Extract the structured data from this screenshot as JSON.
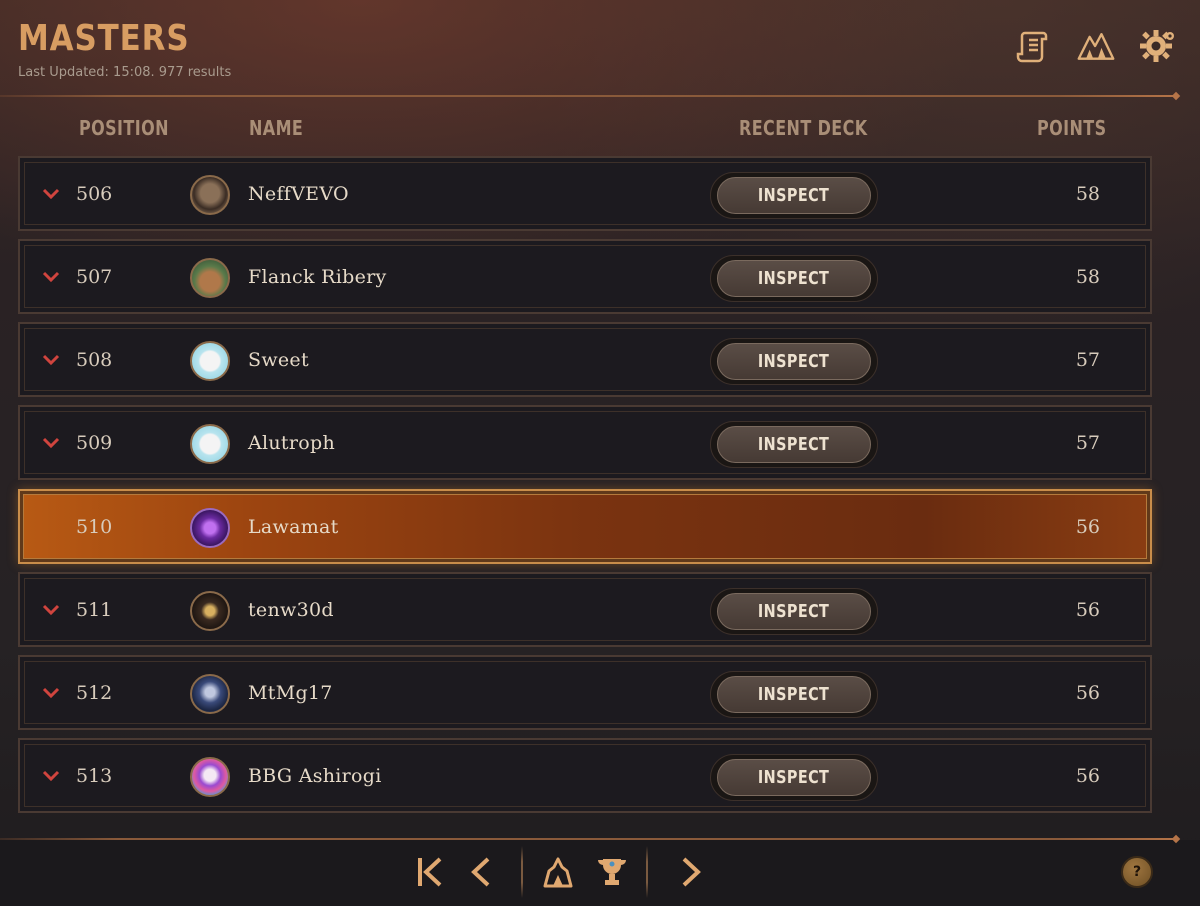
{
  "header": {
    "title": "MASTERS",
    "subtitle": "Last Updated: 15:08. 977 results",
    "icons": [
      "scroll-icon",
      "mountain-peaks-icon",
      "gear-icon"
    ]
  },
  "columns": {
    "position": "POSITION",
    "name": "NAME",
    "recent_deck": "RECENT DECK",
    "points": "POINTS"
  },
  "rows": [
    {
      "position": "506",
      "name": "NeffVEVO",
      "points": "58",
      "button": "INSPECT",
      "trend": "down",
      "highlight": false
    },
    {
      "position": "507",
      "name": "Flanck Ribery",
      "points": "58",
      "button": "INSPECT",
      "trend": "down",
      "highlight": false
    },
    {
      "position": "508",
      "name": "Sweet",
      "points": "57",
      "button": "INSPECT",
      "trend": "down",
      "highlight": false
    },
    {
      "position": "509",
      "name": "Alutroph",
      "points": "57",
      "button": "INSPECT",
      "trend": "down",
      "highlight": false
    },
    {
      "position": "510",
      "name": "Lawamat",
      "points": "56",
      "button": "",
      "trend": "none",
      "highlight": true
    },
    {
      "position": "511",
      "name": "tenw30d",
      "points": "56",
      "button": "INSPECT",
      "trend": "down",
      "highlight": false
    },
    {
      "position": "512",
      "name": "MtMg17",
      "points": "56",
      "button": "INSPECT",
      "trend": "down",
      "highlight": false
    },
    {
      "position": "513",
      "name": "BBG Ashirogi",
      "points": "56",
      "button": "INSPECT",
      "trend": "down",
      "highlight": false
    }
  ],
  "footer": {
    "help_label": "?",
    "icons": [
      "first-page-icon",
      "prev-page-icon",
      "region-icon",
      "trophy-icon",
      "next-page-icon"
    ]
  },
  "colors": {
    "accent": "#d89d62",
    "highlight_row": "#9d4510",
    "trend_down": "#d0443e"
  }
}
